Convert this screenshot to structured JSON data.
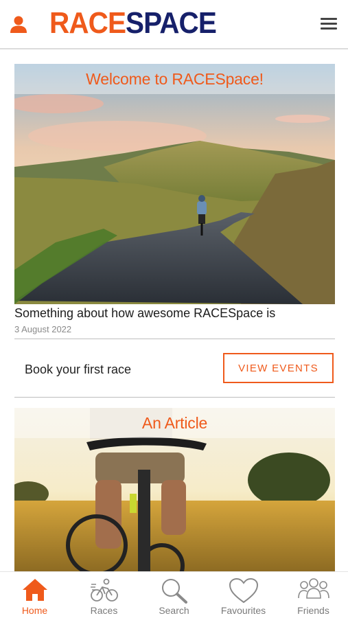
{
  "header": {
    "logo_part1": "RACE",
    "logo_part2": "SPACE",
    "profile_icon": "user-icon",
    "menu_icon": "hamburger-menu-icon"
  },
  "feed": {
    "hero": {
      "banner_title": "Welcome to RACESpace!",
      "headline": "Something about how awesome RACESpace is",
      "date": "3 August 2022"
    },
    "promo": {
      "text": "Book your first race",
      "button_label": "VIEW EVENTS"
    },
    "article": {
      "banner_title": "An Article"
    }
  },
  "tabbar": {
    "tabs": [
      {
        "label": "Home",
        "icon": "home-icon",
        "active": true
      },
      {
        "label": "Races",
        "icon": "cyclist-icon",
        "active": false
      },
      {
        "label": "Search",
        "icon": "search-icon",
        "active": false
      },
      {
        "label": "Favourites",
        "icon": "heart-icon",
        "active": false
      },
      {
        "label": "Friends",
        "icon": "group-icon",
        "active": false
      }
    ]
  },
  "colors": {
    "accent": "#ef5a1b",
    "brand_navy": "#16206a",
    "inactive": "#7a7a7a"
  }
}
